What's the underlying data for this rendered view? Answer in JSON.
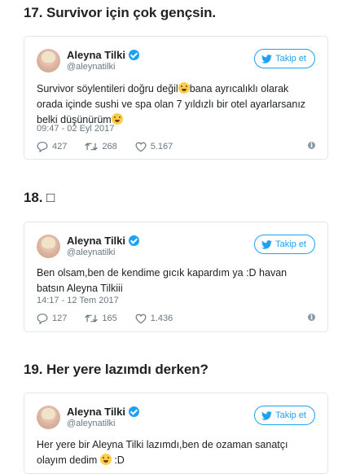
{
  "items": [
    {
      "heading": "17. Survivor için çok gençsin.",
      "author": {
        "name": "Aleyna Tilki",
        "handle": "@aleynatilki"
      },
      "follow_label": "Takip et",
      "text_before": "Survivor söylentileri doğru değil",
      "text_after": "bana ayrıcalıklı olarak orada içinde sushi ve spa olan 7 yıldızlı bir otel ayarlarsanız belki düşünürüm",
      "timestamp": "09:47 - 02 Eyl 2017",
      "replies": "427",
      "retweets": "268",
      "likes": "5.167"
    },
    {
      "heading": "18. □",
      "author": {
        "name": "Aleyna Tilki",
        "handle": "@aleynatilki"
      },
      "follow_label": "Takip et",
      "text": "Ben olsam,ben de kendime gıcık kapardım ya :D havan batsın Aleyna Tilkiii",
      "timestamp": "14:17 - 12 Tem 2017",
      "replies": "127",
      "retweets": "165",
      "likes": "1.436"
    },
    {
      "heading": "19. Her yere lazımdı derken?",
      "author": {
        "name": "Aleyna Tilki",
        "handle": "@aleynatilki"
      },
      "follow_label": "Takip et",
      "text_before": "Her yere bir Aleyna Tilki lazımdı,ben de ozaman sanatçı olayım dedim",
      "text_after": ":D"
    }
  ],
  "colors": {
    "accent": "#1da1f2",
    "muted": "#697882",
    "border": "#e1e8ed"
  }
}
